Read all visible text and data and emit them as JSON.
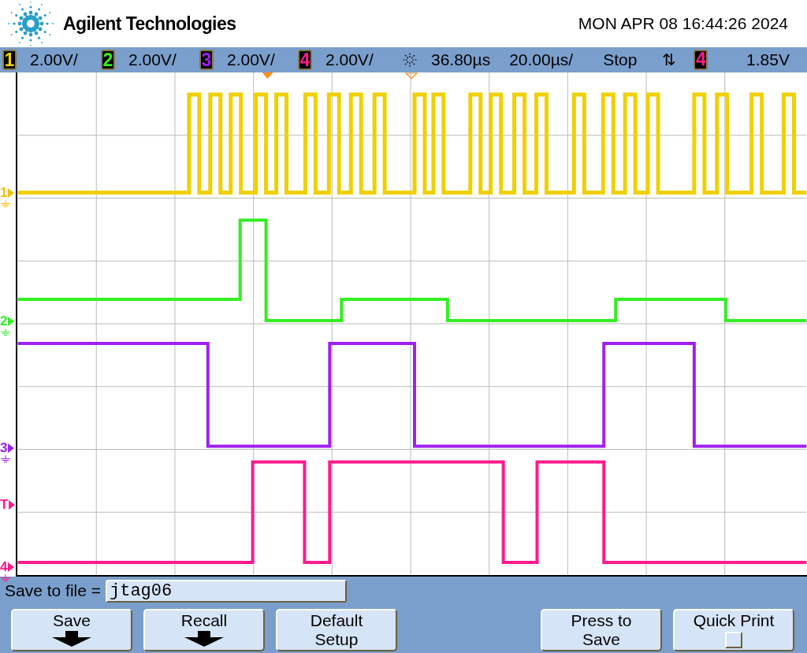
{
  "header": {
    "brand": "Agilent Technologies",
    "datetime": "MON APR 08 16:44:26 2024"
  },
  "status_bar": {
    "channels": [
      {
        "number": "1",
        "scale": "2.00V/",
        "color": "#f0d000"
      },
      {
        "number": "2",
        "scale": "2.00V/",
        "color": "#33ee22"
      },
      {
        "number": "3",
        "scale": "2.00V/",
        "color": "#a020f0"
      },
      {
        "number": "4",
        "scale": "2.00V/",
        "color": "#ff1a8c"
      }
    ],
    "time_reference": "36.80µs",
    "time_scale": "20.00µs/",
    "run_state": "Stop",
    "trigger_slope": "⇅",
    "trigger_channel": {
      "number": "4"
    },
    "trigger_level": "1.85V"
  },
  "display": {
    "markers": [
      {
        "label": "1",
        "kind": "ground",
        "color": "#f0c000"
      },
      {
        "label": "2",
        "kind": "ground",
        "color": "#33ee22"
      },
      {
        "label": "3",
        "kind": "ground",
        "color": "#a020f0"
      },
      {
        "label": "T",
        "kind": "trigger",
        "color": "#ff1a8c"
      },
      {
        "label": "4",
        "kind": "ground",
        "color": "#ff1a8c"
      }
    ]
  },
  "save_bar": {
    "label": "Save to file =",
    "filename": "jtag06"
  },
  "softkeys": [
    {
      "kind": "menu",
      "label": "Save"
    },
    {
      "kind": "menu",
      "label": "Recall"
    },
    {
      "kind": "plain",
      "label": "Default Setup"
    },
    {
      "kind": "empty"
    },
    {
      "kind": "plain",
      "label": "Press to Save"
    },
    {
      "kind": "checkbox",
      "label": "Quick Print",
      "checked": false
    }
  ]
}
